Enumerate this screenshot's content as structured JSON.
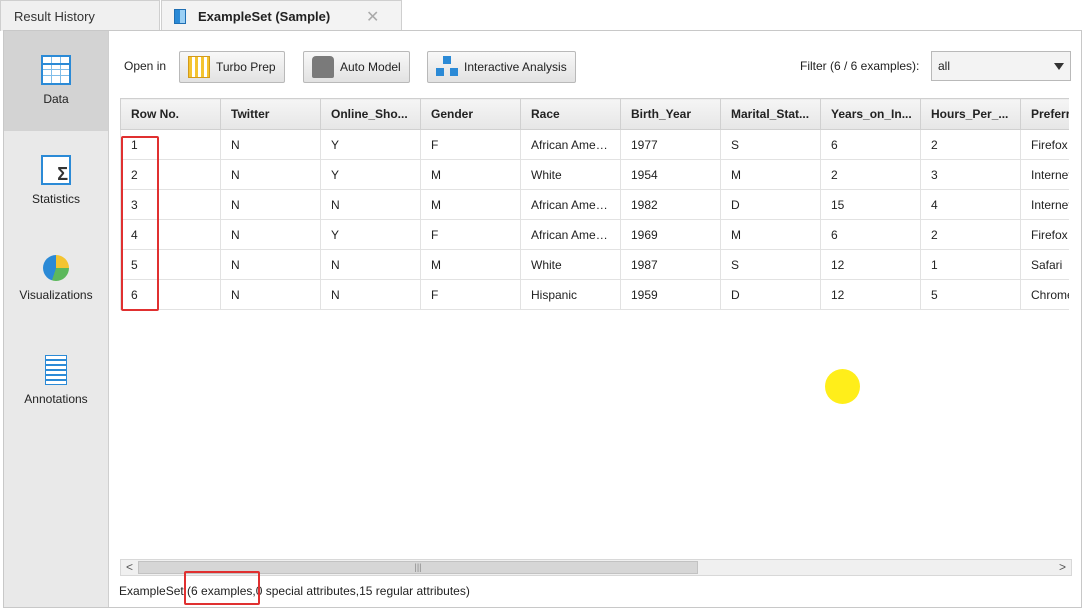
{
  "tabs": {
    "history_label": "Result History",
    "example_label": "ExampleSet (Sample)",
    "close_glyph": "✕"
  },
  "nav": {
    "items": [
      {
        "label": "Data",
        "icon": "data-grid-icon"
      },
      {
        "label": "Statistics",
        "icon": "statistics-sigma-icon"
      },
      {
        "label": "Visualizations",
        "icon": "visualization-chart-icon"
      },
      {
        "label": "Annotations",
        "icon": "annotations-notepad-icon"
      }
    ]
  },
  "toolbar": {
    "open_in_label": "Open in",
    "turbo_prep_label": "Turbo Prep",
    "auto_model_label": "Auto Model",
    "interactive_analysis_label": "Interactive Analysis",
    "filter_label": "Filter (6 / 6 examples):",
    "filter_value": "all"
  },
  "table": {
    "headers": [
      "Row No.",
      "Twitter",
      "Online_Sho...",
      "Gender",
      "Race",
      "Birth_Year",
      "Marital_Stat...",
      "Years_on_In...",
      "Hours_Per_...",
      "Preferr"
    ],
    "rows": [
      [
        "1",
        "N",
        "Y",
        "F",
        "African Ameri...",
        "1977",
        "S",
        "6",
        "2",
        "Firefox"
      ],
      [
        "2",
        "N",
        "Y",
        "M",
        "White",
        "1954",
        "M",
        "2",
        "3",
        "Internet"
      ],
      [
        "3",
        "N",
        "N",
        "M",
        "African Ameri...",
        "1982",
        "D",
        "15",
        "4",
        "Internet"
      ],
      [
        "4",
        "N",
        "Y",
        "F",
        "African Ameri...",
        "1969",
        "M",
        "6",
        "2",
        "Firefox"
      ],
      [
        "5",
        "N",
        "N",
        "M",
        "White",
        "1987",
        "S",
        "12",
        "1",
        "Safari"
      ],
      [
        "6",
        "N",
        "N",
        "F",
        "Hispanic",
        "1959",
        "D",
        "12",
        "5",
        "Chrome"
      ]
    ]
  },
  "scrollbar": {
    "left_arrow": "<",
    "right_arrow": ">",
    "thumb_grip": "|||"
  },
  "status": {
    "text": "ExampleSet (6 examples,0 special attributes,15 regular attributes)"
  },
  "colors": {
    "highlight": "#e03030",
    "cursor": "#ffee1a",
    "accent": "#2b8ad6"
  }
}
